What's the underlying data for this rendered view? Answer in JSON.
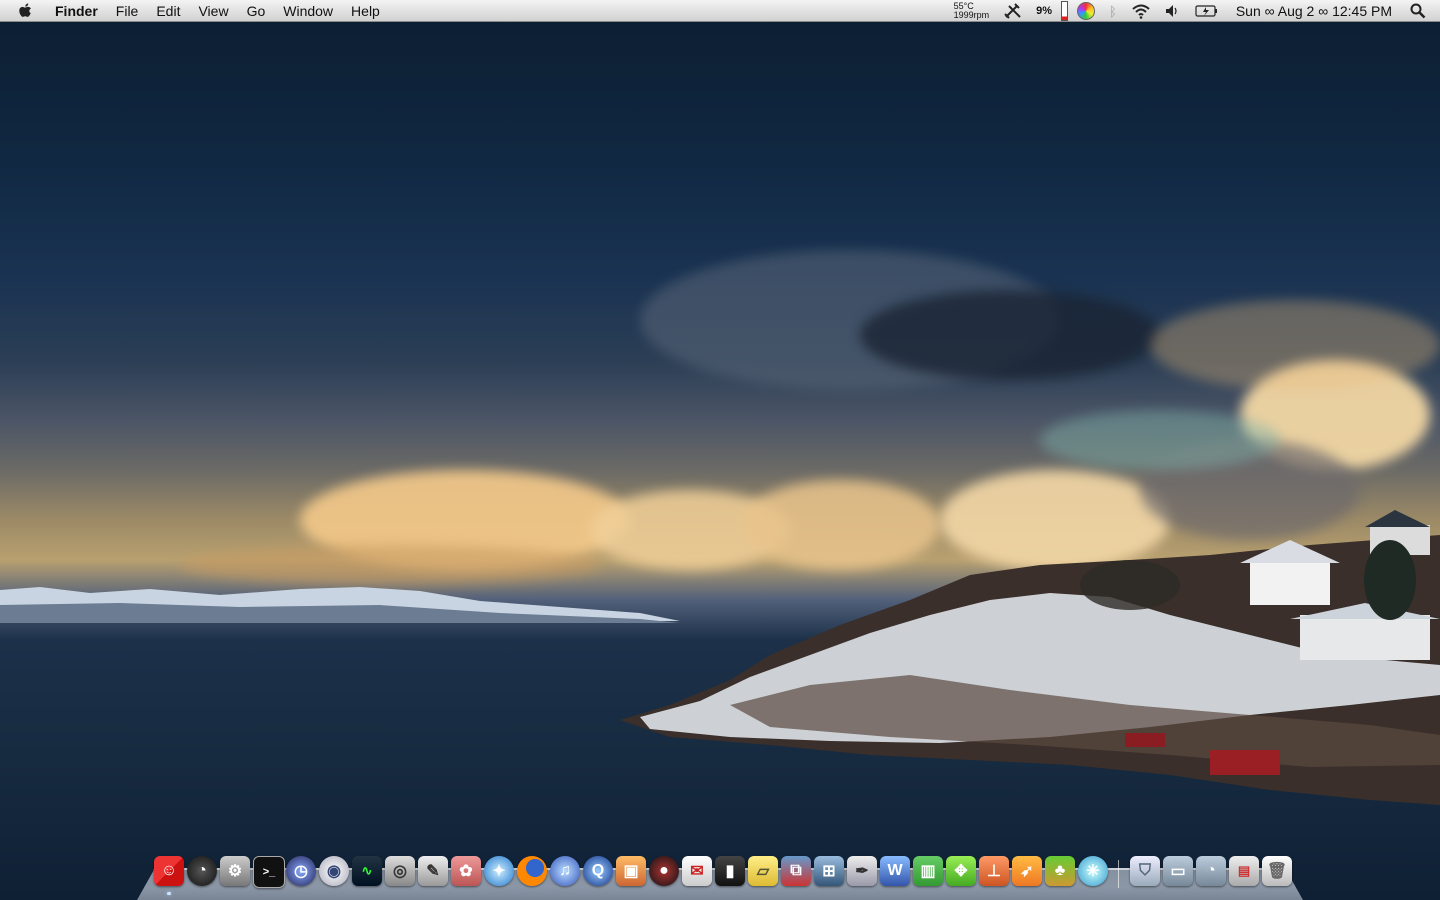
{
  "menubar": {
    "app_name": "Finder",
    "menus": [
      "File",
      "Edit",
      "View",
      "Go",
      "Window",
      "Help"
    ],
    "status": {
      "temperature": "55°C",
      "fan_speed": "1999rpm",
      "cpu_percent": "9%",
      "clock": "Sun ∞ Aug 2 ∞ 12:45 PM"
    },
    "icons": [
      "apple-icon",
      "tools-icon",
      "cpu-meter-icon",
      "color-wheel-icon",
      "bluetooth-icon",
      "wifi-icon",
      "volume-icon",
      "battery-icon",
      "spotlight-icon"
    ]
  },
  "dock": {
    "apps": [
      "finder",
      "dashboard",
      "system-preferences",
      "terminal",
      "time-machine",
      "airport-utility",
      "activity-monitor",
      "disk-utility",
      "script-editor",
      "photo-app",
      "safari",
      "firefox",
      "itunes",
      "quicktime",
      "iphoto",
      "dvd-player",
      "textedit",
      "cardreader",
      "stickies",
      "vmware",
      "spaces",
      "pencil-app",
      "word",
      "numbers",
      "bamboo",
      "keynote",
      "coda",
      "adium",
      "safari-network"
    ],
    "folders": [
      "applications-folder",
      "documents-folder",
      "downloads-folder",
      "desktop-stack",
      "trash"
    ]
  }
}
